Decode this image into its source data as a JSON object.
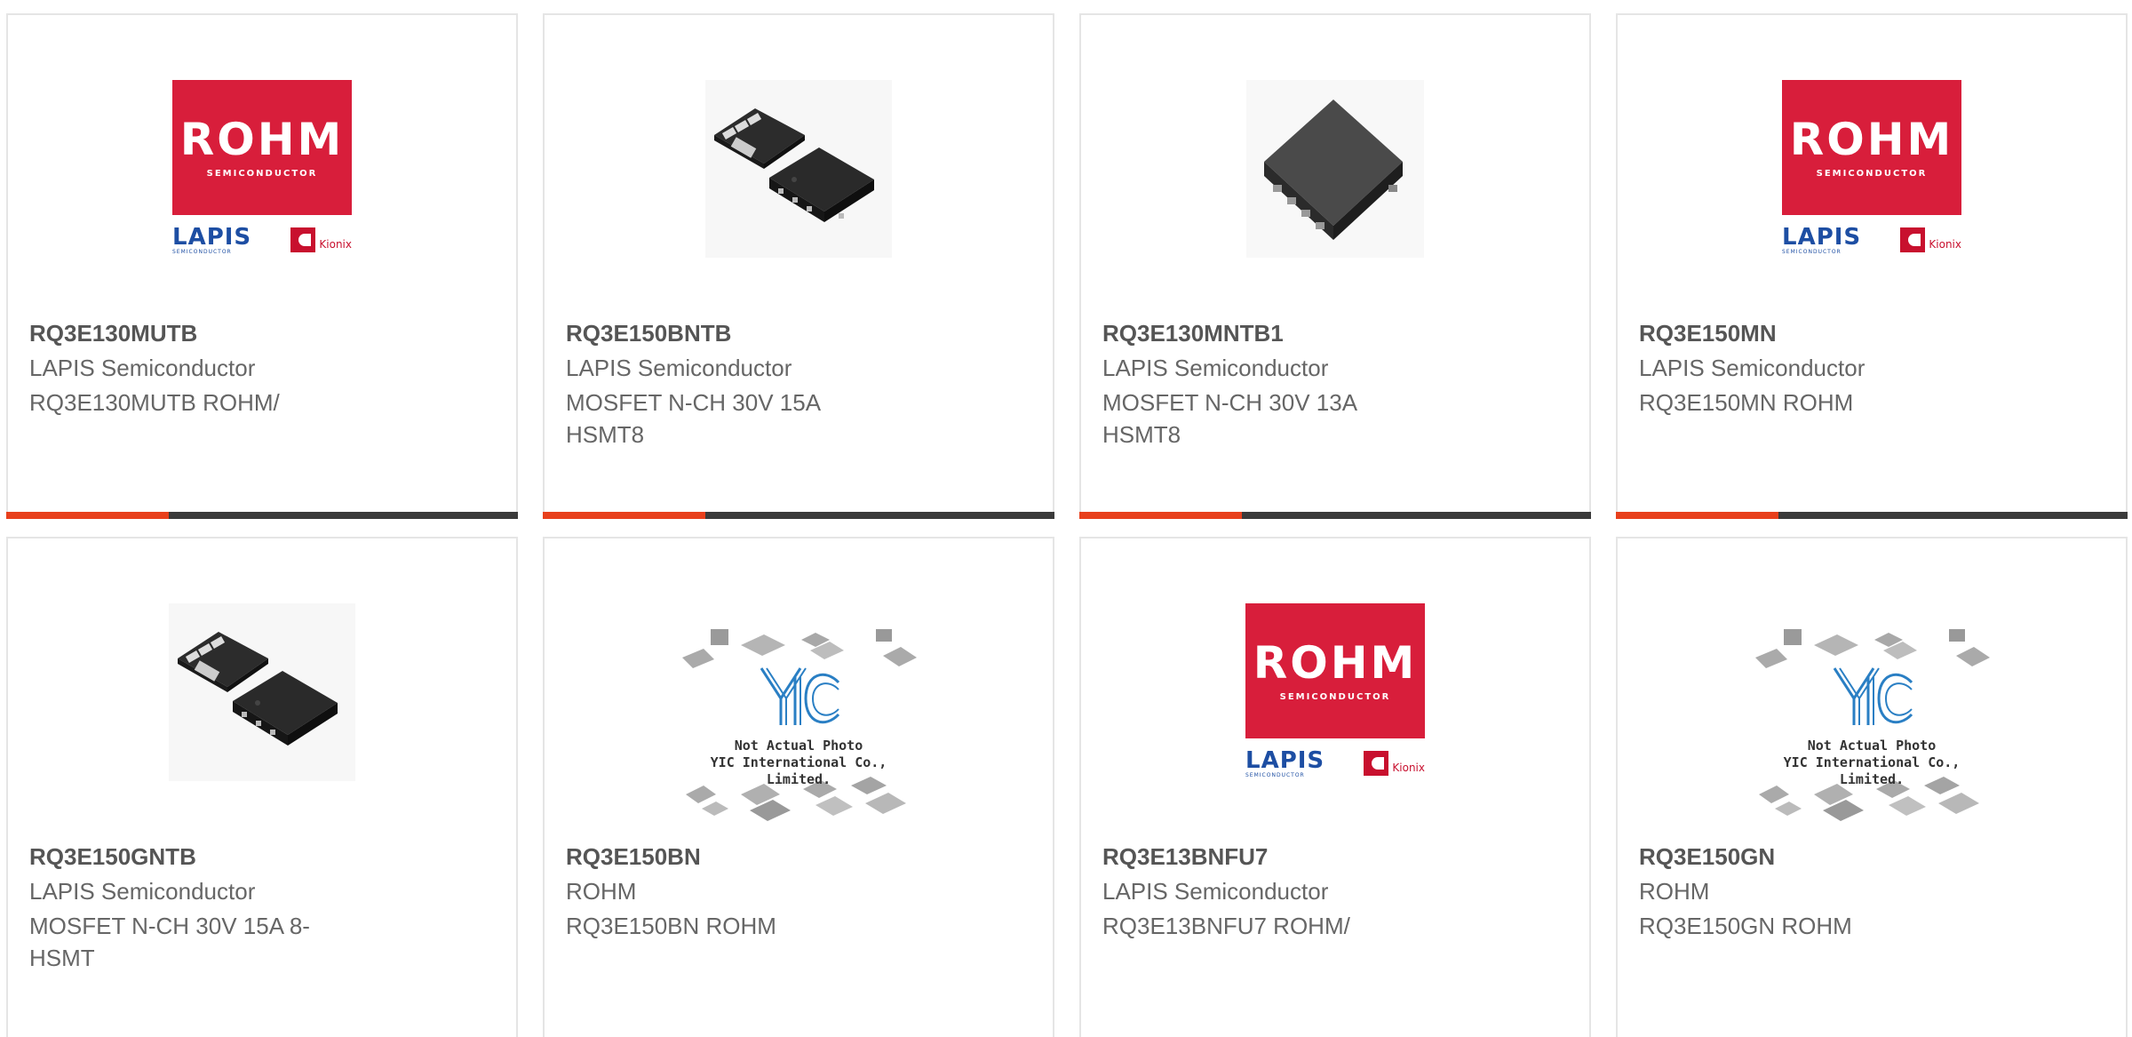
{
  "brand_colors": {
    "accent": "#e8401c",
    "bar": "#3a3a3a",
    "rohm_red": "#d81e3b",
    "lapis_blue": "#1d4ea3",
    "yic_blue": "#2a7fc4"
  },
  "logos": {
    "rohm": "ROHM",
    "rohm_sub": "SEMICONDUCTOR",
    "lapis": "LAPIS",
    "lapis_sub": "SEMICONDUCTOR",
    "kionix": "Kionix"
  },
  "placeholder": {
    "line1": "Not Actual Photo",
    "line2": "YIC International Co., Limited."
  },
  "products": [
    {
      "part_number": "RQ3E130MUTB",
      "manufacturer": "LAPIS Semiconductor",
      "description": "RQ3E130MUTB ROHM/",
      "image": "rohm-logo"
    },
    {
      "part_number": "RQ3E150BNTB",
      "manufacturer": "LAPIS Semiconductor",
      "description": "MOSFET N-CH 30V 15A HSMT8",
      "image": "chip-pair"
    },
    {
      "part_number": "RQ3E130MNTB1",
      "manufacturer": "LAPIS Semiconductor",
      "description": "MOSFET N-CH 30V 13A HSMT8",
      "image": "chip-single"
    },
    {
      "part_number": "RQ3E150MN",
      "manufacturer": "LAPIS Semiconductor",
      "description": "RQ3E150MN ROHM",
      "image": "rohm-logo"
    },
    {
      "part_number": "RQ3E150GNTB",
      "manufacturer": "LAPIS Semiconductor",
      "description": "MOSFET N-CH 30V 15A 8-HSMT",
      "image": "chip-pair"
    },
    {
      "part_number": "RQ3E150BN",
      "manufacturer": "ROHM",
      "description": "RQ3E150BN ROHM",
      "image": "not-actual-photo"
    },
    {
      "part_number": "RQ3E13BNFU7",
      "manufacturer": "LAPIS Semiconductor",
      "description": "RQ3E13BNFU7 ROHM/",
      "image": "rohm-logo"
    },
    {
      "part_number": "RQ3E150GN",
      "manufacturer": "ROHM",
      "description": "RQ3E150GN ROHM",
      "image": "not-actual-photo"
    }
  ]
}
